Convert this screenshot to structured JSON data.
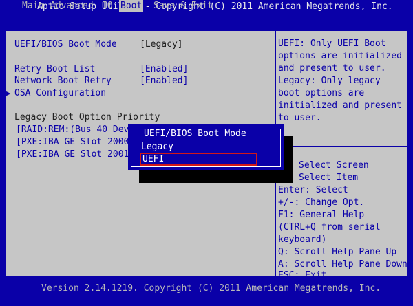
{
  "header": {
    "title": "Aptio Setup Utility - Copyright (C) 2011 American Megatrends, Inc.",
    "tabs": [
      "Main",
      "Advanced",
      "IO",
      "Boot",
      "Save & Exit"
    ],
    "active_tab": "Boot"
  },
  "settings": {
    "boot_mode_label": "UEFI/BIOS Boot Mode",
    "boot_mode_value": "[Legacy]",
    "retry_label": "Retry Boot List",
    "retry_value": "[Enabled]",
    "network_label": "Network Boot Retry",
    "network_value": "[Enabled]",
    "osa_arrow": "▶",
    "osa_label": "OSA Configuration",
    "priority_heading": "Legacy Boot Option Priority",
    "priority_items": [
      "[RAID:REM:(Bus 40 Dev",
      "[PXE:IBA GE Slot 2000",
      "[PXE:IBA GE Slot 2001"
    ]
  },
  "help": {
    "lines": [
      "UEFI: Only UEFI Boot",
      "options are initialized",
      "and present to user.",
      "Legacy: Only legacy",
      "boot options are",
      "initialized and present",
      "to user."
    ],
    "keys": [
      "Select Screen",
      "Select Item",
      "Enter: Select",
      "+/-: Change Opt.",
      "F1: General Help",
      "(CTRL+Q from serial",
      "keyboard)",
      "Q: Scroll Help Pane Up",
      "A: Scroll Help Pane Down",
      "ESC: Exit"
    ]
  },
  "popup": {
    "title": "UEFI/BIOS Boot Mode",
    "options": [
      "Legacy",
      "UEFI"
    ],
    "highlighted": "UEFI"
  },
  "footer": {
    "version": "Version 2.14.1219. Copyright (C) 2011 American Megatrends, Inc."
  }
}
